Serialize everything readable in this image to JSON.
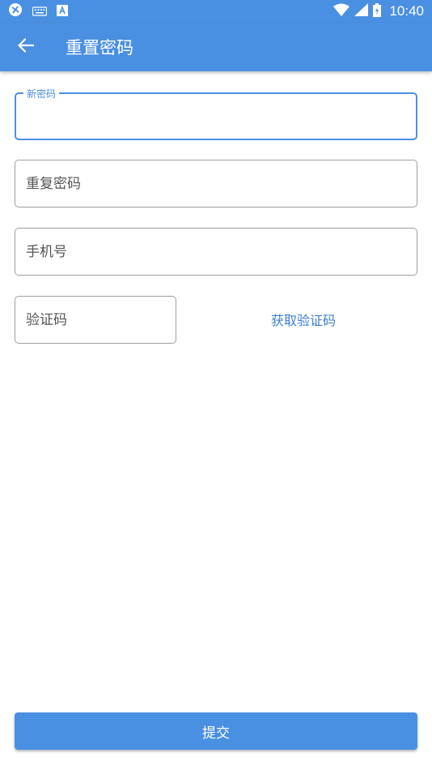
{
  "status_bar": {
    "time": "10:40",
    "icons_left": [
      "vpn-icon",
      "keyboard-icon",
      "a-icon"
    ],
    "icons_right": [
      "wifi-icon",
      "signal-icon",
      "battery-icon"
    ]
  },
  "app_bar": {
    "title": "重置密码",
    "back_icon": "arrow-left-icon",
    "color": "#4a90e2"
  },
  "form": {
    "new_password": {
      "label": "新密码",
      "value": ""
    },
    "repeat_password": {
      "placeholder": "重复密码",
      "value": ""
    },
    "phone": {
      "placeholder": "手机号",
      "value": ""
    },
    "code": {
      "placeholder": "验证码",
      "value": ""
    },
    "get_code_label": "获取验证码"
  },
  "submit_label": "提交"
}
